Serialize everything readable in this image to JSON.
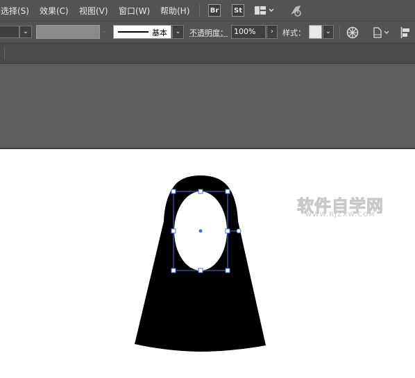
{
  "menu": {
    "items": [
      "选择(S)",
      "效果(C)",
      "视图(V)",
      "窗口(W)",
      "帮助(H)"
    ],
    "bridge_label": "Br",
    "stock_label": "St"
  },
  "control": {
    "stroke_style_label": "基本",
    "opacity_label": "不透明度：",
    "opacity_value": "100%",
    "style_label": "样式："
  },
  "canvas": {
    "shape_fill": "#000000",
    "inner_ellipse_fill": "#ffffff",
    "selection_color": "#4c6ee8"
  },
  "watermark": {
    "text": "软件自学网",
    "subtext": "WWW.RJZXW.COM"
  },
  "icons": {
    "workspace": "workspace-layout-icon",
    "gpu": "gpu-rocket-icon",
    "globe": "recolor-artwork-icon",
    "transform": "transform-icon",
    "align": "align-left-icon"
  }
}
